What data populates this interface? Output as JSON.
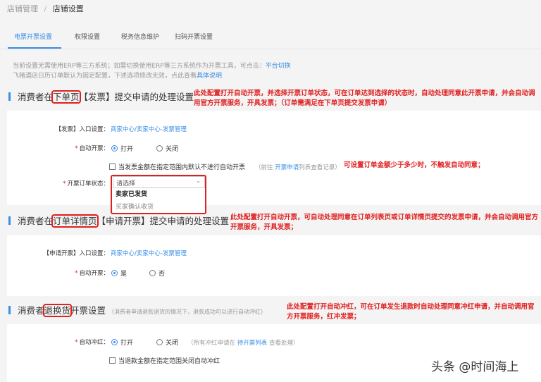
{
  "breadcrumb": {
    "parent": "店铺管理",
    "sep": "/",
    "current": "店铺设置"
  },
  "tabs": [
    {
      "label": "电票开票设置",
      "active": true
    },
    {
      "label": "权限设置"
    },
    {
      "label": "税务信息维护"
    },
    {
      "label": "扫码开票设置"
    }
  ],
  "info": {
    "line1": "当前设置无需使用ERP等三方系统；如需切换使用ERP等三方系统作为开票工具，可点击：",
    "line1_link": "平台切换",
    "line2": "飞猪酒店日历订单默认为固定配置，下述选项修改无效，点此查看",
    "line2_link": "具体说明"
  },
  "section1": {
    "title_pre": "消费者在",
    "title_hl": "下单页",
    "title_post": "【发票】提交申请的处理设置",
    "note": "此处配置打开自动开票，并选择开票订单状态，可在订单达到选择的状态时，自动处理同意此开票申请，并会自动调用官方开票服务，开具发票；（订单需满足在下单页提交发票申请）",
    "entry_label": "【发票】入口设置：",
    "entry_link": "商家中心/卖家中心-发票管理",
    "auto_label": "自动开票：",
    "opt_on": "打开",
    "opt_off": "关闭",
    "checkbox": "当发票金额在指定范围内默认不进行自动开票",
    "hint_pre": "（前往",
    "hint_link": "开票申请",
    "hint_post": "列表查看记录）",
    "checkbox_note": "可设置订单金额少于多少时，不触发自动同意；",
    "status_label": "开票订单状态：",
    "select_placeholder": "请选择",
    "options": [
      "卖家已发货",
      "买家确认收货"
    ]
  },
  "section2": {
    "title_pre": "消费者在",
    "title_hl": "订单详情页",
    "title_post": "【申请开票】提交申请的处理设置",
    "note": "此处配置打开自动开票，可自动处理同意在订单列表页或订单详情页提交的发票申请，并会自动调用官方开票服务，开具发票；",
    "entry_label": "【申请开票】入口设置：",
    "entry_link": "商家中心/卖家中心-发票管理",
    "auto_label": "自动开票：",
    "opt_on": "是",
    "opt_off": "否"
  },
  "section3": {
    "title_pre": "消费者",
    "title_hl": "退换货",
    "title_post": "开票设置",
    "subtitle": "（消费者申请退款退货的情况下，退款成功可以进行自动冲红）",
    "note": "此处配置打开自动冲红，可在订单发生退款时自动处理同意冲红申请，并自动调用官方开票服务，红冲发票；",
    "auto_label": "自动冲红：",
    "opt_on": "打开",
    "opt_off": "关闭",
    "hint_pre": "（所有冲红申请在",
    "hint_link": "待开票列表",
    "hint_post": "查看处理）",
    "checkbox": "当退款金额在指定范围关闭自动冲红"
  },
  "watermark": "头条 @时间海上"
}
